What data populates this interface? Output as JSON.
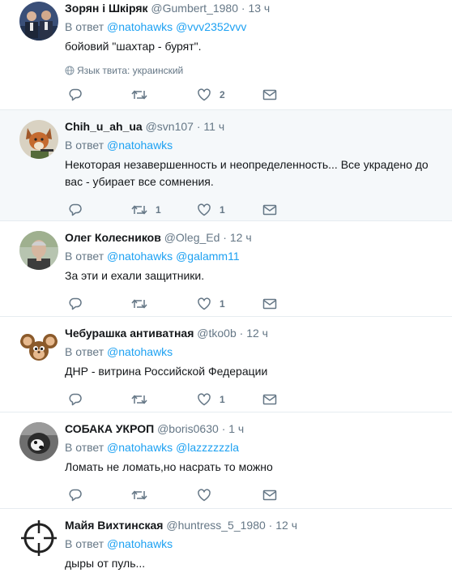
{
  "tweets": [
    {
      "name": "Зорян і Шкіряк",
      "handle": "@Gumbert_1980",
      "time": "13 ч",
      "reply_prefix": "В ответ",
      "mentions": [
        "@natohawks",
        "@vvv2352vvv"
      ],
      "text": "бойовий \"шахтар - бурят\".",
      "language": "Язык твита: украинский",
      "retweets": "",
      "likes": "2",
      "avatar": "two-men-photo"
    },
    {
      "name": "Chih_u_ah_ua",
      "handle": "@svn107",
      "time": "11 ч",
      "reply_prefix": "В ответ",
      "mentions": [
        "@natohawks"
      ],
      "text": "Некоторая незавершенность и неопределенность... Все украдено до вас - убирает все сомнения.",
      "retweets": "1",
      "likes": "1",
      "avatar": "fox-with-gun"
    },
    {
      "name": "Олег Колесников",
      "handle": "@Oleg_Ed",
      "time": "12 ч",
      "reply_prefix": "В ответ",
      "mentions": [
        "@natohawks",
        "@galamm11"
      ],
      "text": "За эти и ехали защитники.",
      "retweets": "",
      "likes": "1",
      "avatar": "man-portrait"
    },
    {
      "name": "Чебурашка антиватная",
      "handle": "@tko0b",
      "time": "12 ч",
      "reply_prefix": "В ответ",
      "mentions": [
        "@natohawks"
      ],
      "text": "ДНР - витрина Российской Федерации",
      "retweets": "",
      "likes": "1",
      "avatar": "cheburashka"
    },
    {
      "name": "СОБАКА УКРОП",
      "handle": "@boris0630",
      "time": "1 ч",
      "reply_prefix": "В ответ",
      "mentions": [
        "@natohawks",
        "@lazzzzzzla"
      ],
      "text": "Ломать не ломать,но насрать то можно",
      "retweets": "",
      "likes": "",
      "avatar": "dog-photo"
    },
    {
      "name": "Майя Вихтинская",
      "handle": "@huntress_5_1980",
      "time": "12 ч",
      "reply_prefix": "В ответ",
      "mentions": [
        "@natohawks"
      ],
      "text": "дыры от пуль...",
      "avatar": "crosshair"
    }
  ],
  "colors": {
    "link": "#1da1f2",
    "muted": "#657786",
    "highlight_bg": "#f5f8fa",
    "divider": "#e6ecf0"
  },
  "icons": [
    "reply-icon",
    "retweet-icon",
    "like-icon",
    "direct-message-icon",
    "globe-icon"
  ]
}
